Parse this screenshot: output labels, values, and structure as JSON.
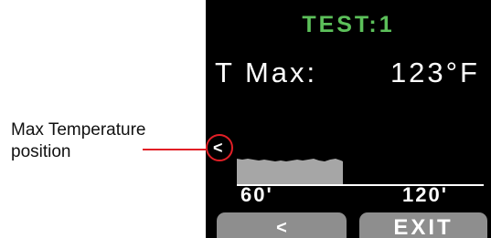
{
  "callout": {
    "line1": "Max Temperature",
    "line2": "position",
    "color": "#e21f26"
  },
  "screen": {
    "title": "TEST:1",
    "title_color": "#5cc05a",
    "tmax_label": "T Max:",
    "tmax_value": "123°F",
    "marker": "<",
    "histogram_color": "#a6a6a6",
    "x_ticks": [
      "60'",
      "120'"
    ],
    "soft_keys": {
      "left": "<",
      "right": "EXIT"
    }
  }
}
